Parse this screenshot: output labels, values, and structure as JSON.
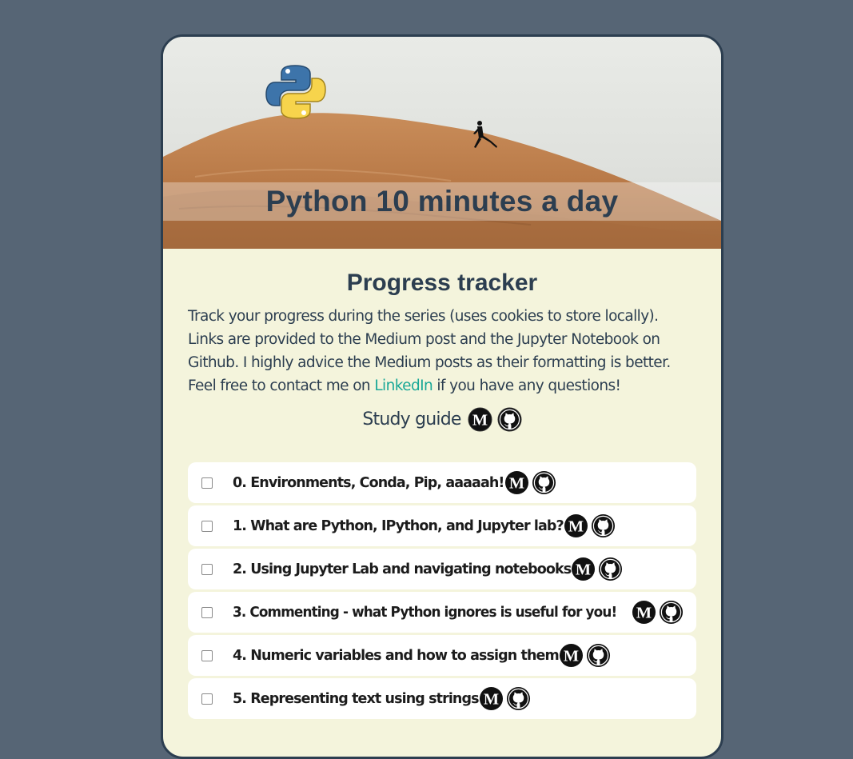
{
  "hero": {
    "banner_title": "Python 10 minutes a day"
  },
  "main": {
    "title": "Progress tracker",
    "intro_before_link": "Track your progress during the series (uses cookies to store locally). Links are provided to the Medium post and the Jupyter Notebook on Github. I highly advice the Medium posts as their formatting is better. Feel free to contact me on ",
    "intro_link": "LinkedIn",
    "intro_after_link": " if you have any questions!",
    "study_guide_label": "Study guide"
  },
  "lessons": [
    {
      "label": "0. Environments, Conda, Pip, aaaaah!",
      "checked": false
    },
    {
      "label": "1. What are Python, IPython, and Jupyter lab?",
      "checked": false
    },
    {
      "label": "2. Using Jupyter Lab and navigating notebooks",
      "checked": false
    },
    {
      "label": "3. Commenting - what Python ignores is useful for you!",
      "checked": false
    },
    {
      "label": "4. Numeric variables and how to assign them",
      "checked": false
    },
    {
      "label": "5. Representing text using strings",
      "checked": false
    }
  ],
  "icons": {
    "medium": "medium-icon",
    "github": "github-icon"
  },
  "colors": {
    "background": "#566575",
    "card": "#f4f4dc",
    "text": "#2c3e50",
    "link": "#1aa897"
  }
}
